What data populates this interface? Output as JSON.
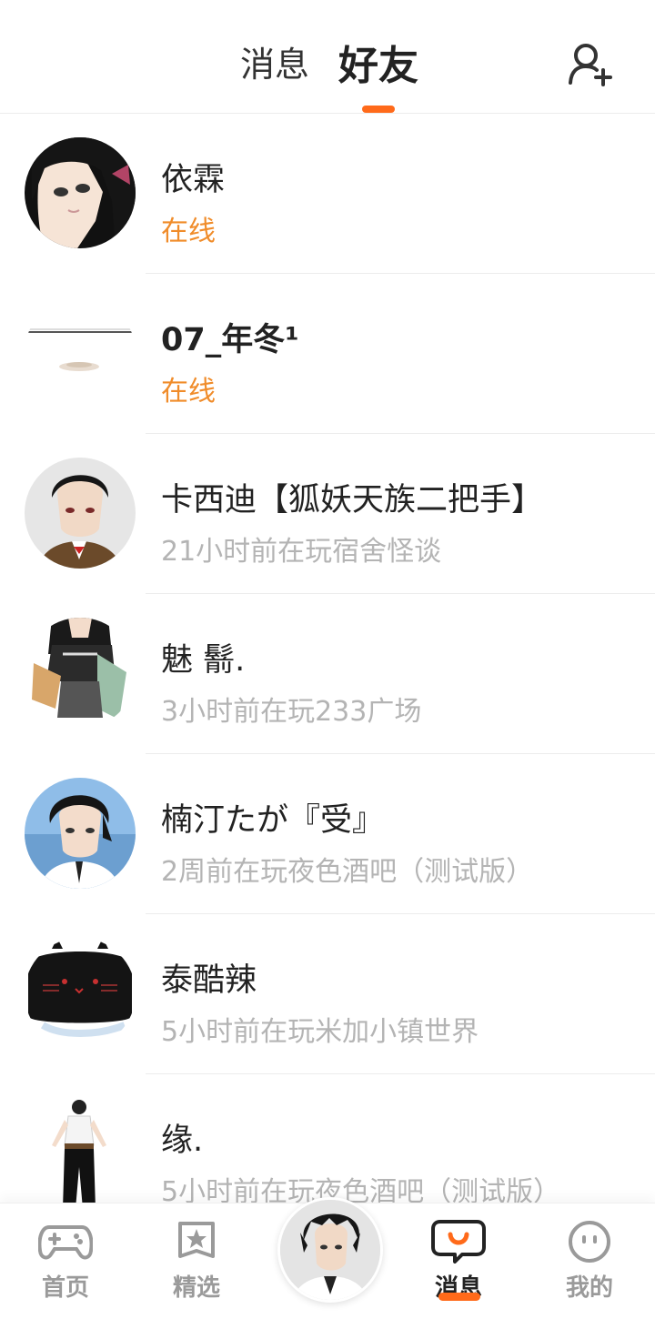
{
  "header": {
    "tabs": [
      {
        "label": "消息",
        "active": false
      },
      {
        "label": "好友",
        "active": true
      }
    ],
    "accent_color": "#ff6a1a",
    "add_friend_icon": "add-user-icon"
  },
  "friends": [
    {
      "name": "依霖",
      "status": "在线",
      "online": true,
      "avatar": "anime-girl-avatar"
    },
    {
      "name": "07_年冬¹",
      "status": "在线",
      "online": true,
      "avatar": "faint-cup-avatar"
    },
    {
      "name": "卡西迪【狐妖天族二把手】",
      "status": "21小时前在玩宿舍怪谈",
      "online": false,
      "avatar": "suited-boy-avatar"
    },
    {
      "name": "魅 鬋.",
      "status": "3小时前在玩233广场",
      "online": false,
      "avatar": "costume-avatar"
    },
    {
      "name": "楠汀たが『受』",
      "status": "2周前在玩夜色酒吧（测试版）",
      "online": false,
      "avatar": "sky-boy-avatar"
    },
    {
      "name": "泰酷辣",
      "status": "5小时前在玩米加小镇世界",
      "online": false,
      "avatar": "black-cat-avatar"
    },
    {
      "name": "缘.",
      "status": "5小时前在玩夜色酒吧（测试版）",
      "online": false,
      "avatar": "standing-figure-avatar"
    }
  ],
  "status_colors": {
    "online": "#f08c2a",
    "offline": "#b4b4b4"
  },
  "bottom_nav": {
    "items": [
      {
        "label": "首页",
        "icon": "gamepad-icon"
      },
      {
        "label": "精选",
        "icon": "star-badge-icon"
      },
      {
        "label": "消息",
        "icon": "chat-bubble-icon",
        "active": true
      },
      {
        "label": "我的",
        "icon": "smiley-face-icon"
      }
    ],
    "center_avatar": "player-avatar"
  }
}
